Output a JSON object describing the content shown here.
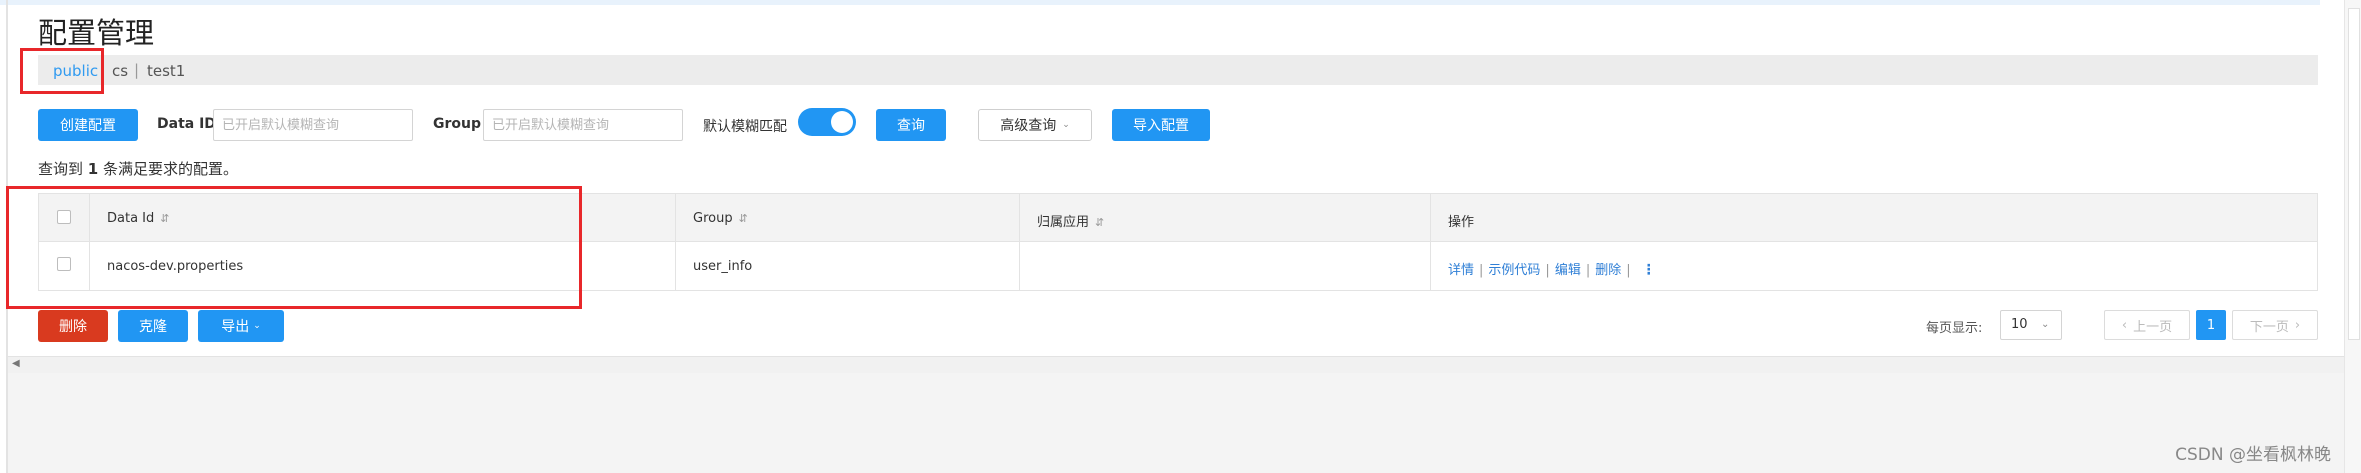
{
  "page": {
    "title": "配置管理"
  },
  "namespaces": {
    "items": [
      "public",
      "cs",
      "test1"
    ],
    "separator": "|",
    "active": "public"
  },
  "toolbar": {
    "create_label": "创建配置",
    "dataid_label": "Data ID",
    "dataid_placeholder": "已开启默认模糊查询",
    "group_label": "Group",
    "group_placeholder": "已开启默认模糊查询",
    "fuzzy_label": "默认模糊匹配",
    "fuzzy_on": true,
    "query_label": "查询",
    "advanced_label": "高级查询",
    "import_label": "导入配置"
  },
  "result": {
    "prefix": "查询到",
    "count": "1",
    "suffix": "条满足要求的配置。"
  },
  "table": {
    "headers": {
      "dataid": "Data Id",
      "group": "Group",
      "app": "归属应用",
      "ops": "操作"
    },
    "sort_icon": "⇵",
    "rows": [
      {
        "dataid": "nacos-dev.properties",
        "group": "user_info",
        "app": ""
      }
    ],
    "ops": [
      "详情",
      "示例代码",
      "编辑",
      "删除"
    ],
    "op_separator": "|",
    "more_icon": "⋮"
  },
  "bottom": {
    "delete_label": "删除",
    "clone_label": "克隆",
    "export_label": "导出",
    "page_size_label": "每页显示:",
    "page_size_value": "10",
    "prev_label": "上一页",
    "next_label": "下一页",
    "current_page": "1"
  },
  "watermark": "CSDN @坐看枫林晚",
  "colors": {
    "accent": "#2196f3",
    "danger": "#d93a1f",
    "highlight_box": "#e8272a"
  }
}
